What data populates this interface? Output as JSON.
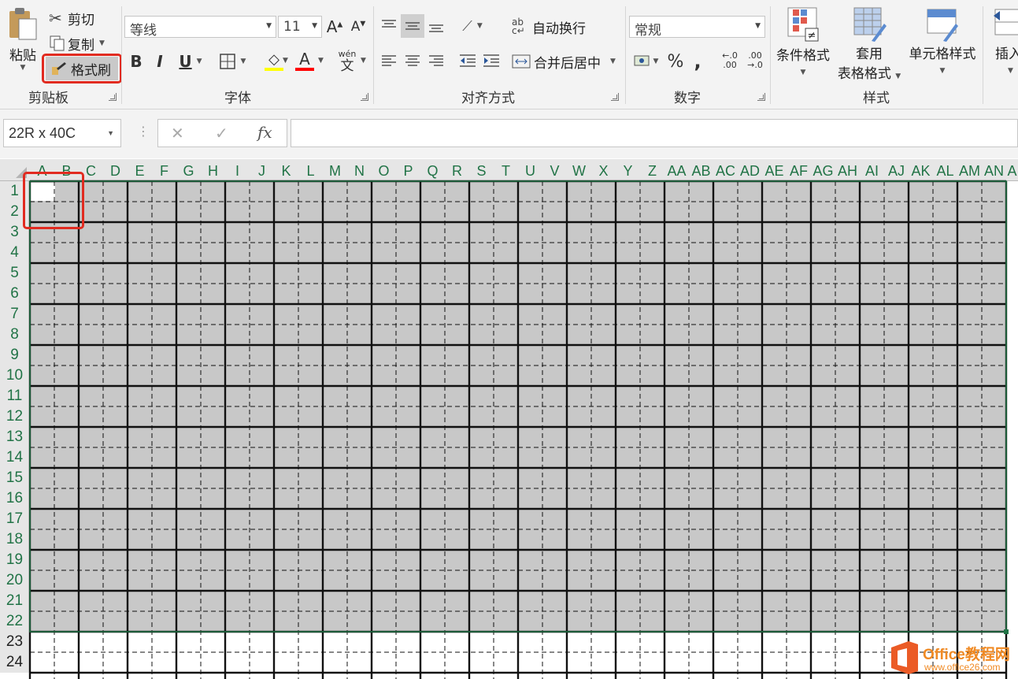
{
  "clipboard": {
    "paste_label": "粘贴",
    "cut_label": "剪切",
    "copy_label": "复制",
    "format_painter_label": "格式刷",
    "group_label": "剪贴板"
  },
  "font": {
    "font_name": "等线",
    "font_size": "11",
    "bold": "B",
    "italic": "I",
    "underline": "U",
    "phonetic_top": "wén",
    "phonetic_bottom": "文",
    "group_label": "字体",
    "fill_color": "#ffff00",
    "font_color": "#ff0000"
  },
  "alignment": {
    "wrap_text_label": "自动换行",
    "merge_center_label": "合并后居中",
    "group_label": "对齐方式"
  },
  "number": {
    "format": "常规",
    "percent": "%",
    "comma": ",",
    "inc_decimal": ".00",
    "dec_decimal": ".0",
    "group_label": "数字"
  },
  "styles": {
    "conditional_label": "条件格式",
    "table_format_label_1": "套用",
    "table_format_label_2": "表格格式",
    "cell_styles_label": "单元格样式",
    "group_label": "样式"
  },
  "cells": {
    "insert_label": "插入"
  },
  "formula_bar": {
    "name_box": "22R x 40C",
    "cancel": "✕",
    "enter": "✓",
    "fx": "fx"
  },
  "sheet": {
    "columns": [
      "A",
      "B",
      "C",
      "D",
      "E",
      "F",
      "G",
      "H",
      "I",
      "J",
      "K",
      "L",
      "M",
      "N",
      "O",
      "P",
      "Q",
      "R",
      "S",
      "T",
      "U",
      "V",
      "W",
      "X",
      "Y",
      "Z",
      "AA",
      "AB",
      "AC",
      "AD",
      "AE",
      "AF",
      "AG",
      "AH",
      "AI",
      "AJ",
      "AK",
      "AL",
      "AM",
      "AN",
      "A"
    ],
    "rows": [
      "1",
      "2",
      "3",
      "4",
      "5",
      "6",
      "7",
      "8",
      "9",
      "10",
      "11",
      "12",
      "13",
      "14",
      "15",
      "16",
      "17",
      "18",
      "19",
      "20",
      "21",
      "22",
      "23",
      "24"
    ],
    "selection_fill": "#c8c8c8",
    "accent": "#217346"
  },
  "watermark": {
    "brand": "Office教程网",
    "url": "www.office26.com"
  }
}
